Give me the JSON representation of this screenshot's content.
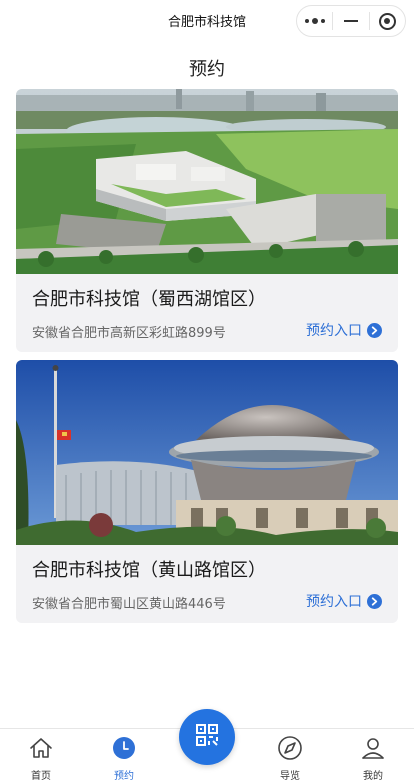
{
  "nav": {
    "title": "合肥市科技馆"
  },
  "page": {
    "heading": "预约"
  },
  "venues": [
    {
      "name": "合肥市科技馆（蜀西湖馆区）",
      "address": "安徽省合肥市高新区彩虹路899号",
      "link_label": "预约入口"
    },
    {
      "name": "合肥市科技馆（黄山路馆区）",
      "address": "安徽省合肥市蜀山区黄山路446号",
      "link_label": "预约入口"
    }
  ],
  "tabbar": {
    "items": [
      {
        "label": "首页",
        "icon": "home-icon",
        "active": false
      },
      {
        "label": "预约",
        "icon": "clock-icon",
        "active": true
      },
      {
        "label": "",
        "icon": "qr-code-icon",
        "active": false
      },
      {
        "label": "导览",
        "icon": "compass-icon",
        "active": false
      },
      {
        "label": "我的",
        "icon": "user-icon",
        "active": false
      }
    ]
  },
  "colors": {
    "accent": "#2e70d6",
    "scan_button": "#2473e0",
    "card_background": "#f2f2f4"
  }
}
